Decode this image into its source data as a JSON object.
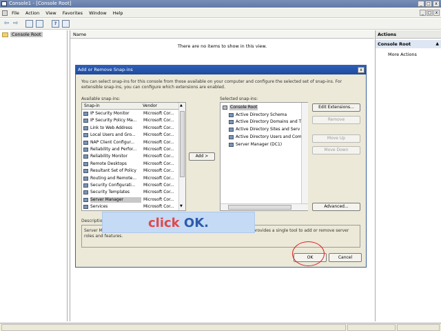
{
  "window": {
    "title": "Console1 - [Console Root]",
    "buttons": [
      "_",
      "□",
      "x"
    ]
  },
  "menu": {
    "items": [
      "File",
      "Action",
      "View",
      "Favorites",
      "Window",
      "Help"
    ],
    "doc_buttons": [
      "_",
      "□",
      "x"
    ]
  },
  "toolbar": {
    "back": "⇦",
    "forward": "⇨",
    "help": "?"
  },
  "left": {
    "root_label": "Console Root"
  },
  "center": {
    "column_name": "Name",
    "empty_message": "There are no items to show in this view."
  },
  "actions": {
    "header": "Actions",
    "section": "Console Root",
    "more": "More Actions",
    "arrow": "▲"
  },
  "dialog": {
    "title": "Add or Remove Snap-ins",
    "close": "x",
    "intro": "You can select snap-ins for this console from those available on your computer and configure the selected set of snap-ins. For extensible snap-ins, you can configure which extensions are enabled.",
    "available_label": "Available snap-ins:",
    "col_snapin": "Snap-in",
    "col_vendor": "Vendor",
    "available": [
      {
        "name": "IP Security Monitor",
        "vendor": "Microsoft Cor..."
      },
      {
        "name": "IP Security Policy Ma...",
        "vendor": "Microsoft Cor..."
      },
      {
        "name": "Link to Web Address",
        "vendor": "Microsoft Cor..."
      },
      {
        "name": "Local Users and Gro...",
        "vendor": "Microsoft Cor..."
      },
      {
        "name": "NAP Client Configur...",
        "vendor": "Microsoft Cor..."
      },
      {
        "name": "Reliability and Perfor...",
        "vendor": "Microsoft Cor..."
      },
      {
        "name": "Reliability Monitor",
        "vendor": "Microsoft Cor..."
      },
      {
        "name": "Remote Desktops",
        "vendor": "Microsoft Cor..."
      },
      {
        "name": "Resultant Set of Policy",
        "vendor": "Microsoft Cor..."
      },
      {
        "name": "Routing and Remote...",
        "vendor": "Microsoft Cor..."
      },
      {
        "name": "Security Configurati...",
        "vendor": "Microsoft Cor..."
      },
      {
        "name": "Security Templates",
        "vendor": "Microsoft Cor..."
      },
      {
        "name": "Server Manager",
        "vendor": "Microsoft Cor..."
      },
      {
        "name": "Services",
        "vendor": "Microsoft Cor..."
      }
    ],
    "add_button": "Add >",
    "selected_label": "Selected snap-ins:",
    "selected": [
      "Console Root",
      "Active Directory Schema",
      "Active Directory Domains and T",
      "Active Directory Sites and Serv",
      "Active Directory Users and Com",
      "Server Manager (DC1)"
    ],
    "edit_extensions": "Edit Extensions...",
    "remove": "Remove",
    "move_up": "Move Up",
    "move_down": "Move Down",
    "advanced": "Advanced...",
    "description_label": "Description:",
    "description_text": "Server Manager is a snap-in that lets you view and manage roles and features. It provides a single tool to add or remove server roles and features.",
    "ok": "OK",
    "cancel": "Cancel"
  },
  "callout": {
    "word1": "click",
    "word2": "OK."
  }
}
